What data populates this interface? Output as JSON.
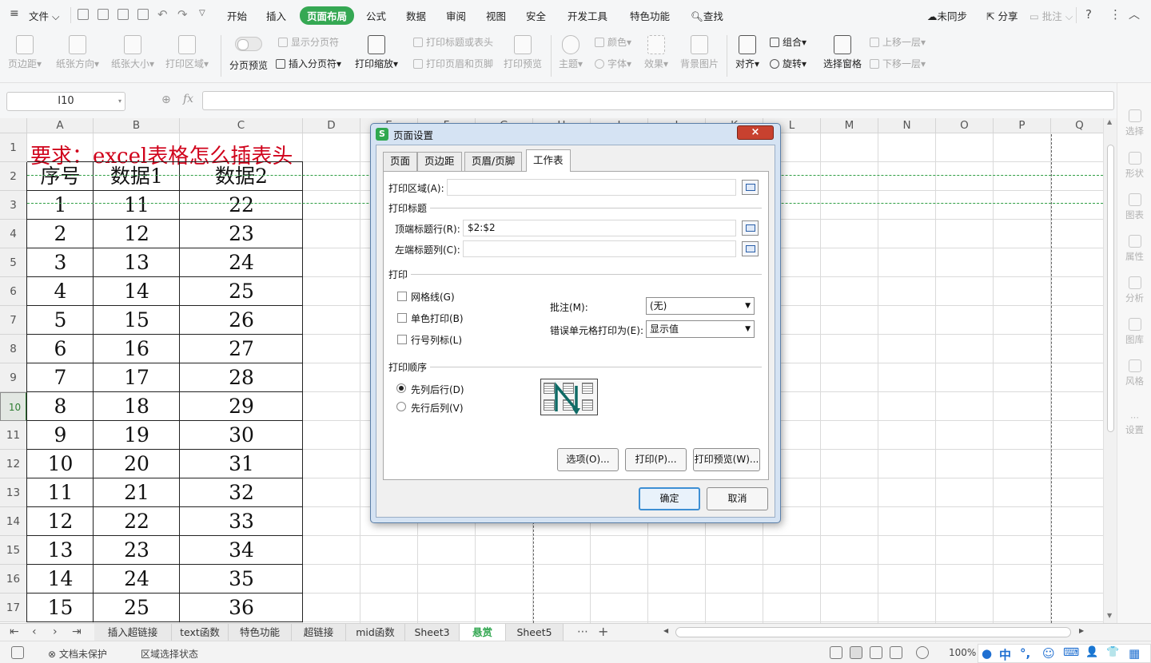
{
  "menubar": {
    "file": "文件",
    "tabs": [
      "开始",
      "插入",
      "页面布局",
      "公式",
      "数据",
      "审阅",
      "视图",
      "安全",
      "开发工具",
      "特色功能"
    ],
    "active_tab": "页面布局",
    "search": "查找",
    "sync": "未同步",
    "share": "分享",
    "comment": "批注"
  },
  "ribbon": {
    "margins": "页边距",
    "orientation": "纸张方向",
    "paper_size": "纸张大小",
    "print_area": "打印区域",
    "page_break_preview": "分页预览",
    "show_page_breaks": "显示分页符",
    "insert_page_break": "插入分页符",
    "print_scale": "打印缩放",
    "print_titles": "打印标题或表头",
    "print_header_footer": "打印页眉和页脚",
    "print_preview": "打印预览",
    "theme": "主题",
    "colors": "颜色",
    "fonts": "字体",
    "effects": "效果",
    "background": "背景图片",
    "align": "对齐",
    "group": "组合",
    "rotate": "旋转",
    "selection_pane": "选择窗格",
    "bring_forward": "上移一层",
    "send_backward": "下移一层"
  },
  "formula_bar": {
    "name_box": "I10",
    "fx": "fx"
  },
  "sheet": {
    "columns": [
      "A",
      "B",
      "C",
      "D",
      "E",
      "F",
      "G",
      "H",
      "I",
      "J",
      "K",
      "L",
      "M",
      "N",
      "O",
      "P",
      "Q"
    ],
    "rows": [
      "1",
      "2",
      "3",
      "4",
      "5",
      "6",
      "7",
      "8",
      "9",
      "10",
      "11",
      "12",
      "13",
      "14",
      "15",
      "16",
      "17"
    ],
    "title": "要求：excel表格怎么插表头",
    "headers": [
      "序号",
      "数据1",
      "数据2"
    ],
    "data": [
      [
        "1",
        "11",
        "22"
      ],
      [
        "2",
        "12",
        "23"
      ],
      [
        "3",
        "13",
        "24"
      ],
      [
        "4",
        "14",
        "25"
      ],
      [
        "5",
        "15",
        "26"
      ],
      [
        "6",
        "16",
        "27"
      ],
      [
        "7",
        "17",
        "28"
      ],
      [
        "8",
        "18",
        "29"
      ],
      [
        "9",
        "19",
        "30"
      ],
      [
        "10",
        "20",
        "31"
      ],
      [
        "11",
        "21",
        "32"
      ],
      [
        "12",
        "22",
        "33"
      ],
      [
        "13",
        "23",
        "34"
      ],
      [
        "14",
        "24",
        "35"
      ],
      [
        "15",
        "25",
        "36"
      ]
    ]
  },
  "side_panel": [
    "选择",
    "形状",
    "图表",
    "属性",
    "分析",
    "图库",
    "风格",
    "设置"
  ],
  "sheet_tabs": [
    "插入超链接",
    "text函数",
    "特色功能",
    "超链接",
    "mid函数",
    "Sheet3",
    "悬赏",
    "Sheet5"
  ],
  "active_sheet": "悬赏",
  "status": {
    "protect": "文档未保护",
    "mode": "区域选择状态",
    "zoom": "100%"
  },
  "ime": [
    "中",
    "°,",
    "☺",
    "⌨",
    "👤",
    "👕",
    "▦"
  ],
  "dialog": {
    "title": "页面设置",
    "close": "×",
    "tabs": [
      "页面",
      "页边距",
      "页眉/页脚",
      "工作表"
    ],
    "active_tab": "工作表",
    "print_area_label": "打印区域(A):",
    "print_area_value": "",
    "print_titles_group": "打印标题",
    "top_rows_label": "顶端标题行(R):",
    "top_rows_value": "$2:$2",
    "left_cols_label": "左端标题列(C):",
    "left_cols_value": "",
    "print_group": "打印",
    "gridlines": "网格线(G)",
    "mono": "单色打印(B)",
    "row_col_headings": "行号列标(L)",
    "comments_label": "批注(M):",
    "comments_value": "(无)",
    "errors_label": "错误单元格打印为(E):",
    "errors_value": "显示值",
    "order_group": "打印顺序",
    "down_then_over": "先列后行(D)",
    "over_then_down": "先行后列(V)",
    "options_btn": "选项(O)...",
    "print_btn": "打印(P)...",
    "preview_btn": "打印预览(W)...",
    "ok_btn": "确定",
    "cancel_btn": "取消"
  }
}
